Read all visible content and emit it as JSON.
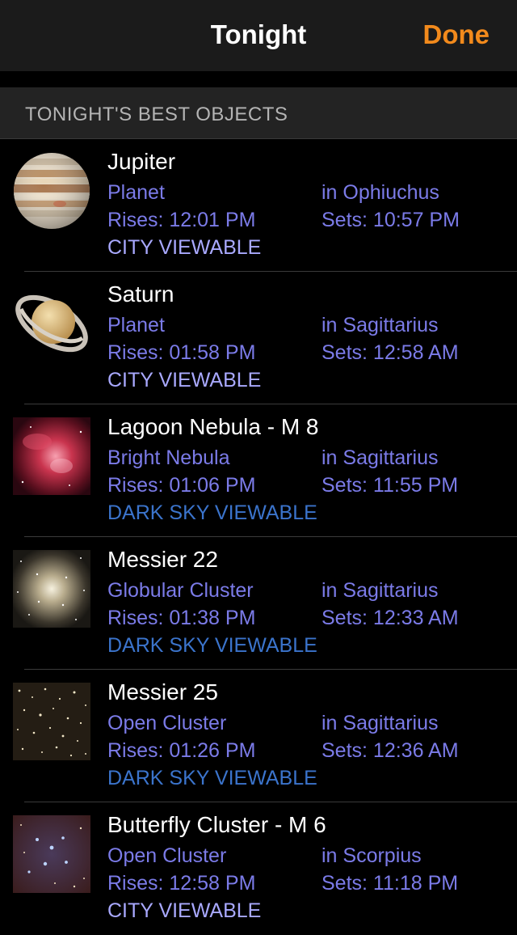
{
  "nav": {
    "title": "Tonight",
    "done_label": "Done"
  },
  "section": {
    "header": "TONIGHT'S BEST OBJECTS"
  },
  "colors": {
    "accent": "#f28a1c",
    "link": "#7b7be8",
    "city": "#a9a9ff",
    "dark": "#3b74cc"
  },
  "objects": [
    {
      "name": "Jupiter",
      "type": "Planet",
      "constellation": "in Ophiuchus",
      "rises": "Rises: 12:01 PM",
      "sets": "Sets: 10:57 PM",
      "viewable": "CITY VIEWABLE",
      "icon": "jupiter-icon"
    },
    {
      "name": "Saturn",
      "type": "Planet",
      "constellation": "in Sagittarius",
      "rises": "Rises: 01:58 PM",
      "sets": "Sets: 12:58 AM",
      "viewable": "CITY VIEWABLE",
      "icon": "saturn-icon"
    },
    {
      "name": "Lagoon Nebula - M 8",
      "type": "Bright Nebula",
      "constellation": "in Sagittarius",
      "rises": "Rises: 01:06 PM",
      "sets": "Sets: 11:55 PM",
      "viewable": "DARK SKY VIEWABLE",
      "icon": "nebula-icon"
    },
    {
      "name": "Messier 22",
      "type": "Globular Cluster",
      "constellation": "in Sagittarius",
      "rises": "Rises: 01:38 PM",
      "sets": "Sets: 12:33 AM",
      "viewable": "DARK SKY VIEWABLE",
      "icon": "globular-cluster-icon"
    },
    {
      "name": "Messier 25",
      "type": "Open Cluster",
      "constellation": "in Sagittarius",
      "rises": "Rises: 01:26 PM",
      "sets": "Sets: 12:36 AM",
      "viewable": "DARK SKY VIEWABLE",
      "icon": "open-cluster-icon"
    },
    {
      "name": "Butterfly Cluster - M 6",
      "type": "Open Cluster",
      "constellation": "in Scorpius",
      "rises": "Rises: 12:58 PM",
      "sets": "Sets: 11:18 PM",
      "viewable": "CITY VIEWABLE",
      "icon": "open-cluster-icon"
    }
  ]
}
